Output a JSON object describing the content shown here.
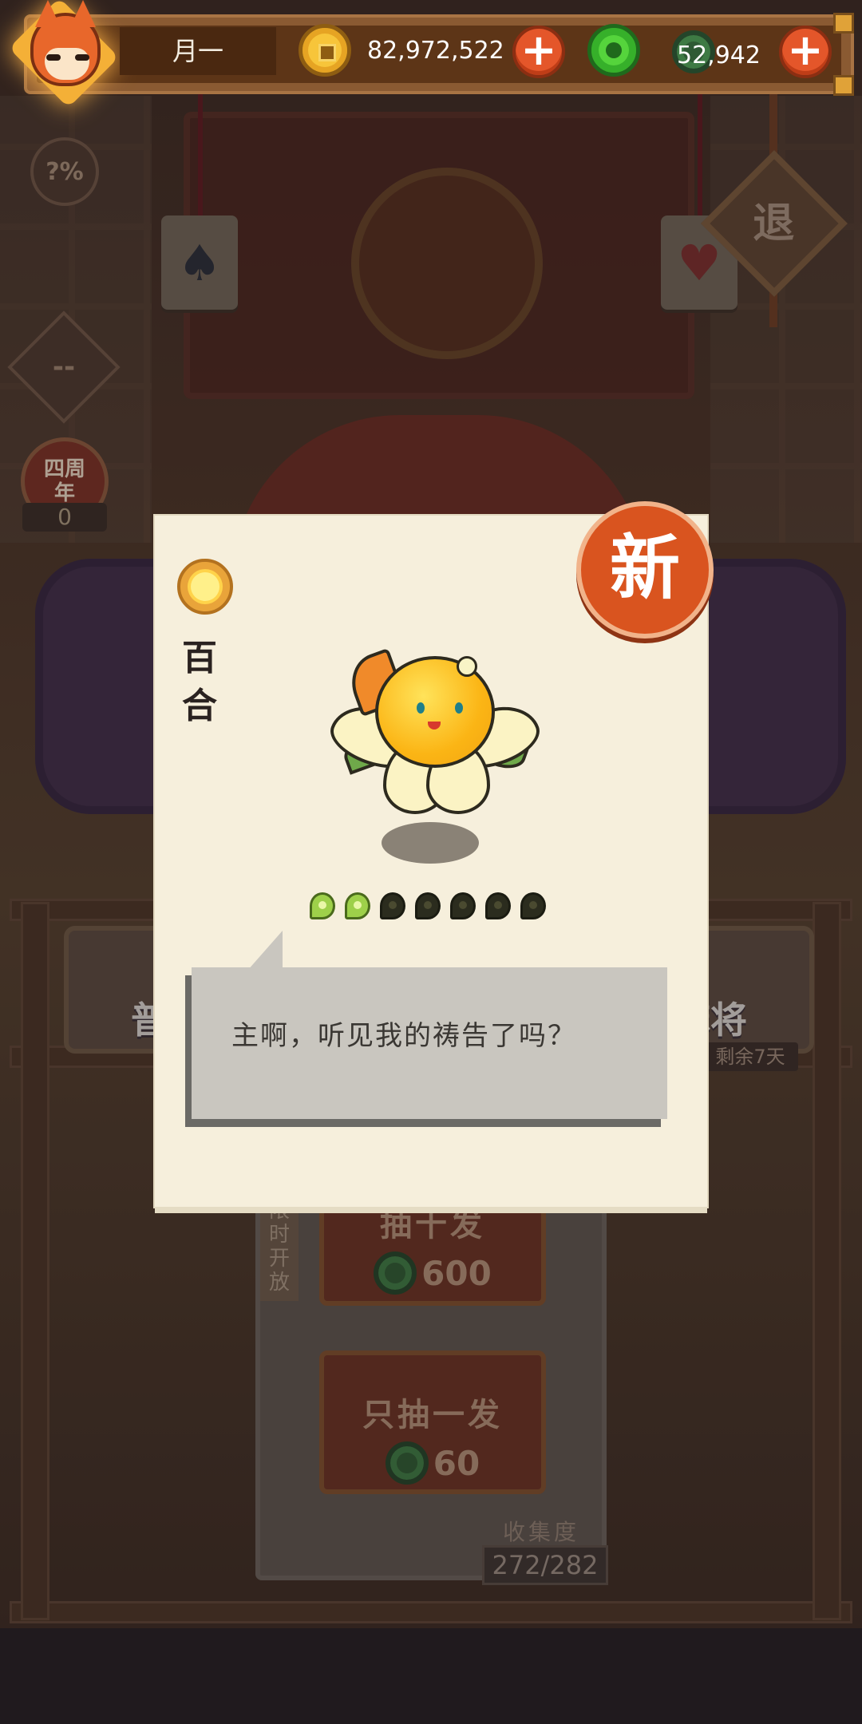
{
  "topbar": {
    "player_name": "月一",
    "gold_amount": "82,972,522",
    "jade_amount": "52,942",
    "add_symbol": "+"
  },
  "sidebar": {
    "odds_label": "?%",
    "badge_label": "--",
    "anniversary_label": "四周年",
    "anniversary_count": "0"
  },
  "exit_label": "退",
  "pools": {
    "left_label": "普通",
    "right_label": "麻将",
    "right_sub": "剩余7天"
  },
  "draw": {
    "limited_label": "限时开放",
    "ten_label": "抽十发",
    "ten_cost": "600",
    "one_label": "只抽一发",
    "one_cost": "60",
    "collection_label": "收集度",
    "collection_value": "272/282"
  },
  "card": {
    "new_label": "新",
    "name_line1": "百",
    "name_line2": "合",
    "quote": "主啊，听见我的祷告了吗？",
    "stars_on": 2,
    "stars_total": 7
  },
  "colors": {
    "accent": "#d9541f",
    "gold_coin": "#f7c53a",
    "jade": "#55d43c",
    "card_bg": "#f6efdc"
  },
  "icons": {
    "gold": "gold-coin-icon",
    "jade": "jade-coin-icon",
    "rarity": "sun-rarity-icon"
  }
}
